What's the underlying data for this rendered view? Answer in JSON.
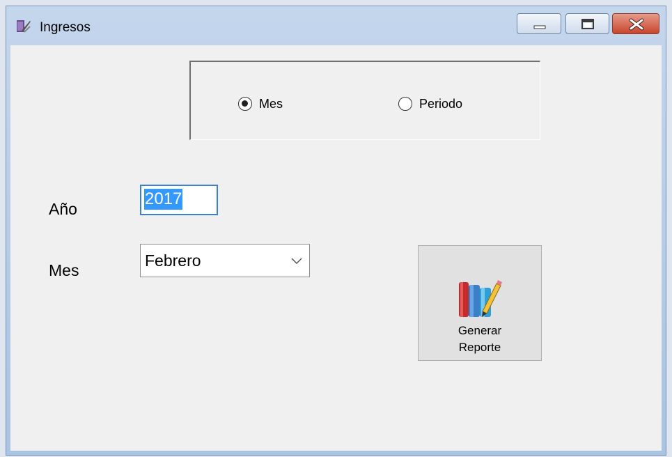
{
  "window": {
    "title": "Ingresos",
    "controls": [
      "minimize-icon",
      "maximize-icon",
      "close-icon"
    ]
  },
  "mode_group": {
    "options": [
      {
        "label": "Mes",
        "checked": true
      },
      {
        "label": "Periodo",
        "checked": false
      }
    ]
  },
  "form": {
    "year_label": "Año",
    "year_value": "2017",
    "month_label": "Mes",
    "month_value": "Febrero"
  },
  "report_button": {
    "line1": "Generar",
    "line2": "Reporte",
    "icon": "books-pencil-icon"
  },
  "colors": {
    "selection": "#3399ff",
    "focus_border": "#3c7fd5",
    "close_button": "#c8452c"
  }
}
